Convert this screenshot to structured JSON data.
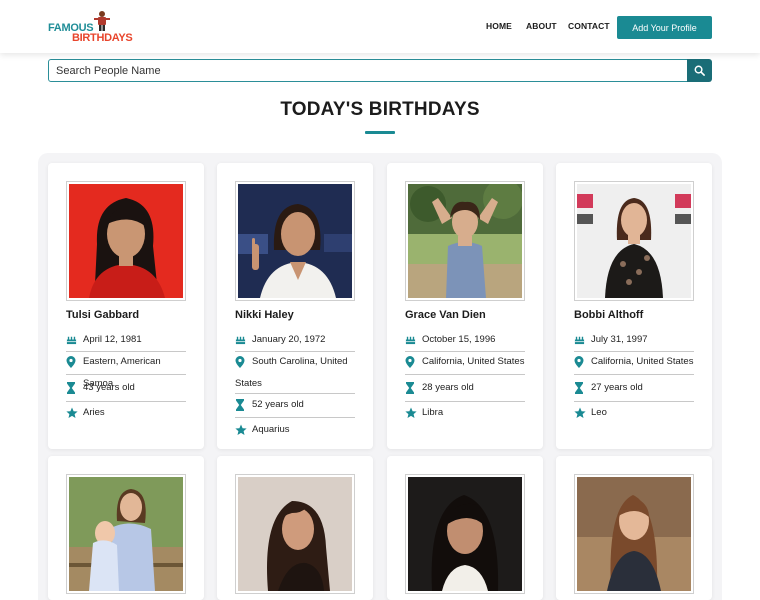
{
  "header": {
    "logo_top": "FAMOUS",
    "logo_bottom": "BIRTHDAYS",
    "nav": [
      "HOME",
      "ABOUT",
      "CONTACT"
    ],
    "add_profile": "Add Your Profile"
  },
  "search": {
    "placeholder": "Search People Name"
  },
  "section_title": "TODAY'S BIRTHDAYS",
  "colors": {
    "accent": "#1a8a93",
    "logo_red": "#e8452c"
  },
  "people": [
    {
      "name": "Tulsi Gabbard",
      "birthday": "April 12, 1981",
      "location": "Eastern, American Samoa",
      "age": "43 years old",
      "sign": "Aries"
    },
    {
      "name": "Nikki Haley",
      "birthday": "January 20, 1972",
      "location": "South Carolina, United States",
      "age": "52 years old",
      "sign": "Aquarius"
    },
    {
      "name": "Grace Van Dien",
      "birthday": "October 15, 1996",
      "location": "California, United States",
      "age": "28 years old",
      "sign": "Libra"
    },
    {
      "name": "Bobbi Althoff",
      "birthday": "July 31, 1997",
      "location": "California, United States",
      "age": "27 years old",
      "sign": "Leo"
    }
  ],
  "icons": [
    "search-icon",
    "cake-icon",
    "location-pin-icon",
    "hourglass-icon",
    "star-icon"
  ]
}
